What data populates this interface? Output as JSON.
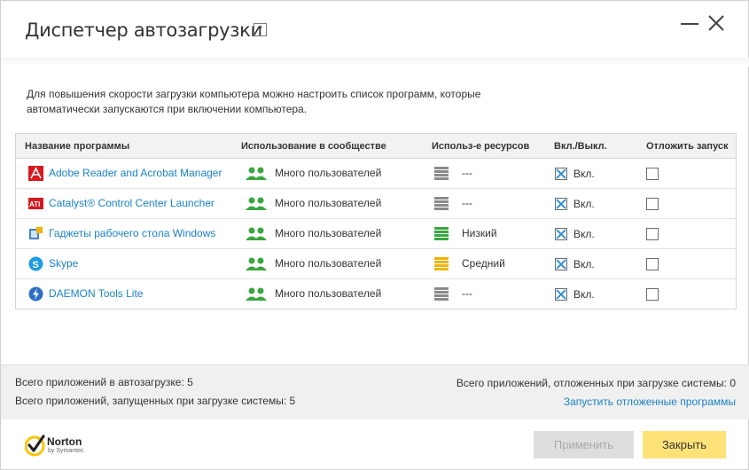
{
  "window": {
    "title": "Диспетчер автозагрузки",
    "help_label": "?"
  },
  "description": "Для повышения скорости загрузки компьютера можно настроить список программ, которые автоматически запускаются при включении компьютера.",
  "table": {
    "headers": {
      "name": "Название программы",
      "community": "Использование в сообществе",
      "resources": "Использ-е ресурсов",
      "onoff": "Вкл./Выкл.",
      "delay": "Отложить запуск"
    },
    "rows": [
      {
        "name": "Adobe Reader and Acrobat Manager",
        "icon": "adobe-icon",
        "community": "Много пользователей",
        "resource": "---",
        "resource_level": "none",
        "enabled": true,
        "enabled_label": "Вкл.",
        "delayed": false
      },
      {
        "name": "Catalyst® Control Center Launcher",
        "icon": "ati-icon",
        "community": "Много пользователей",
        "resource": "---",
        "resource_level": "none",
        "enabled": true,
        "enabled_label": "Вкл.",
        "delayed": false
      },
      {
        "name": "Гаджеты рабочего стола Windows",
        "icon": "windows-gadgets-icon",
        "community": "Много пользователей",
        "resource": "Низкий",
        "resource_level": "low",
        "enabled": true,
        "enabled_label": "Вкл.",
        "delayed": false
      },
      {
        "name": "Skype",
        "icon": "skype-icon",
        "community": "Много пользователей",
        "resource": "Средний",
        "resource_level": "medium",
        "enabled": true,
        "enabled_label": "Вкл.",
        "delayed": false
      },
      {
        "name": "DAEMON Tools Lite",
        "icon": "daemon-tools-icon",
        "community": "Много пользователей",
        "resource": "---",
        "resource_level": "none",
        "enabled": true,
        "enabled_label": "Вкл.",
        "delayed": false
      }
    ]
  },
  "footer": {
    "total_startup": "Всего приложений в автозагрузке: 5",
    "total_launched": "Всего приложений, запущенных при загрузке системы: 5",
    "total_delayed": "Всего приложений, отложенных при загрузке системы: 0",
    "run_delayed_link": "Запустить отложенные программы"
  },
  "brand": {
    "name": "Norton",
    "sub": "by Symantec"
  },
  "buttons": {
    "apply": "Применить",
    "close": "Закрыть"
  },
  "colors": {
    "link": "#1a82c8",
    "community_green": "#3aa641",
    "resource_none": "#8a8a8a",
    "resource_low": "#3aa641",
    "resource_medium": "#f0b400",
    "close_button": "#ffe277",
    "norton_yellow": "#f7c600"
  }
}
